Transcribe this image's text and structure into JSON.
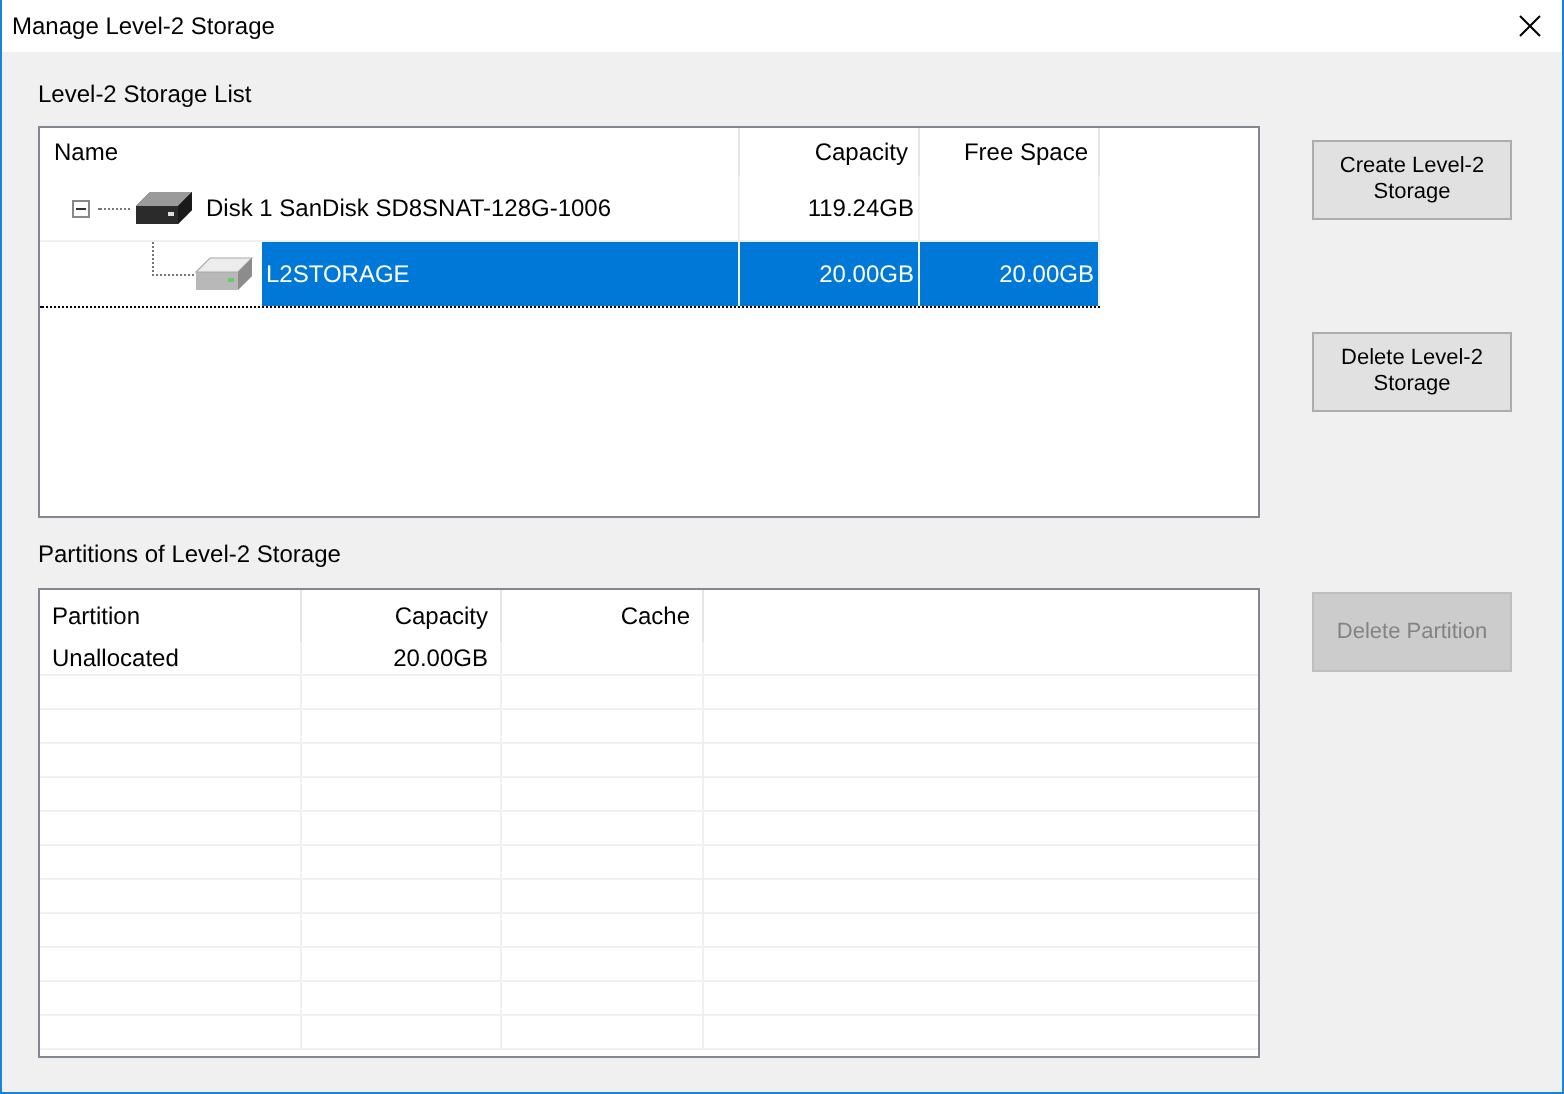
{
  "window": {
    "title": "Manage Level-2 Storage"
  },
  "storage_list": {
    "label": "Level-2 Storage List",
    "columns": [
      "Name",
      "Capacity",
      "Free Space"
    ],
    "items": [
      {
        "name": "Disk 1 SanDisk SD8SNAT-128G-1006",
        "kind": "disk",
        "capacity": "119.24GB",
        "expanded": true,
        "selected": false,
        "children": [
          {
            "name": "L2STORAGE",
            "kind": "storage",
            "capacity": "20.00GB",
            "free_space": "20.00GB",
            "selected": true
          }
        ]
      }
    ]
  },
  "partitions": {
    "label": "Partitions of Level-2 Storage",
    "columns": [
      "Partition",
      "Capacity",
      "Cache"
    ],
    "rows": [
      {
        "partition": "Unallocated",
        "capacity": "20.00GB"
      }
    ]
  },
  "buttons": [
    {
      "label": "Create Level-2 Storage",
      "disabled": false
    },
    {
      "label": "Delete Level-2 Storage",
      "disabled": false
    },
    {
      "label": "Delete Partition",
      "disabled": true
    }
  ]
}
